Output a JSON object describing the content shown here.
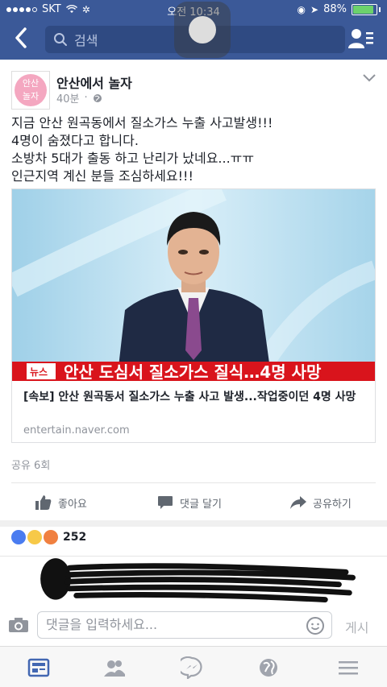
{
  "status_bar": {
    "carrier": "SKT",
    "time": "오전 10:34",
    "battery_percent": "88%",
    "battery_level": 0.88
  },
  "header": {
    "search_placeholder": "검색",
    "back_icon": "back-arrow-icon",
    "friends_icon": "friend-requests-icon"
  },
  "post": {
    "page_name": "안산에서 놀자",
    "avatar_text": "안산\n놀자",
    "time_ago": "40분",
    "lines": [
      "지금 안산 원곡동에서 질소가스 누출 사고발생!!!",
      "4명이 숨졌다고 합니다.",
      "소방차 5대가 출동 하고 난리가 났네요...ㅠㅠ",
      "인근지역 계신 분들 조심하세요!!!"
    ],
    "link": {
      "ticker_badge": "뉴스",
      "ticker_text": "안산 도심서 질소가스 질식…4명 사망",
      "title": "[속보] 안산 원곡동서 질소가스 누출 사고 발생...작업중이던 4명 사망",
      "domain": "entertain.naver.com"
    },
    "shares": "공유 6회",
    "actions": {
      "like": "좋아요",
      "comment": "댓글 달기",
      "share": "공유하기"
    },
    "reaction_count": "252"
  },
  "comment_bar": {
    "placeholder": "댓글을 입력하세요...",
    "post_label": "게시"
  },
  "colors": {
    "facebook_blue": "#3b5998",
    "ticker_red": "#d9141c"
  }
}
